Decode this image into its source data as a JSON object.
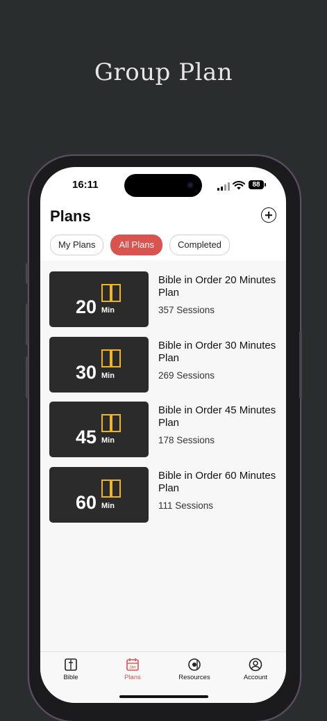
{
  "headline": "Group Plan",
  "status": {
    "time": "16:11",
    "battery": "88"
  },
  "header": {
    "title": "Plans"
  },
  "tabs": [
    {
      "label": "My Plans",
      "active": false
    },
    {
      "label": "All Plans",
      "active": true
    },
    {
      "label": "Completed",
      "active": false
    }
  ],
  "plans": [
    {
      "minutes": "20",
      "unit": "Min",
      "title": "Bible in Order 20 Minutes Plan",
      "sessions": "357 Sessions"
    },
    {
      "minutes": "30",
      "unit": "Min",
      "title": "Bible in Order 30 Minutes Plan",
      "sessions": "269 Sessions"
    },
    {
      "minutes": "45",
      "unit": "Min",
      "title": "Bible in Order 45 Minutes Plan",
      "sessions": "178 Sessions"
    },
    {
      "minutes": "60",
      "unit": "Min",
      "title": "Bible in Order 60 Minutes Plan",
      "sessions": "111 Sessions"
    }
  ],
  "tabbar": [
    {
      "label": "Bible",
      "icon": "bible-icon",
      "active": false
    },
    {
      "label": "Plans",
      "icon": "calendar-icon",
      "calendar_text": "Jan",
      "active": true
    },
    {
      "label": "Resources",
      "icon": "resources-icon",
      "active": false
    },
    {
      "label": "Account",
      "icon": "account-icon",
      "active": false
    }
  ],
  "colors": {
    "accent": "#d9534f",
    "book_icon": "#f0b429",
    "background": "#2a2d2e",
    "thumb": "#2b2b2b"
  }
}
